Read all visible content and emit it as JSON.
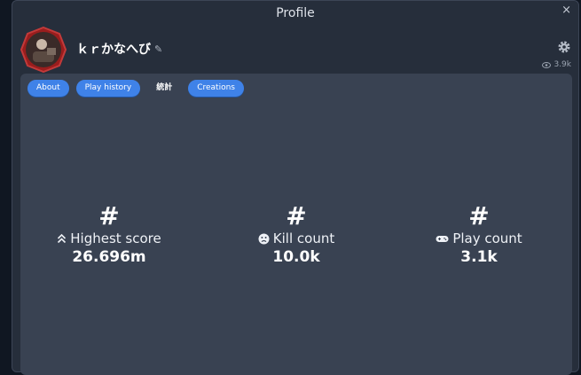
{
  "window": {
    "title": "Profile",
    "close": "×"
  },
  "profile": {
    "username": "ｋｒかなへび",
    "views": "3.9k"
  },
  "tabs": [
    {
      "label": "About"
    },
    {
      "label": "Play history"
    },
    {
      "label": "統計"
    },
    {
      "label": "Creations"
    }
  ],
  "stats": [
    {
      "symbol": "#",
      "label": "Highest score",
      "value": "26.696m",
      "icon": "double-chevron-up-icon"
    },
    {
      "symbol": "#",
      "label": "Kill count",
      "value": "10.0k",
      "icon": "sad-face-icon"
    },
    {
      "symbol": "#",
      "label": "Play count",
      "value": "3.1k",
      "icon": "gamepad-icon"
    }
  ],
  "colors": {
    "accent": "#3f82e8",
    "panel": "#394252",
    "window": "#262e3b"
  }
}
